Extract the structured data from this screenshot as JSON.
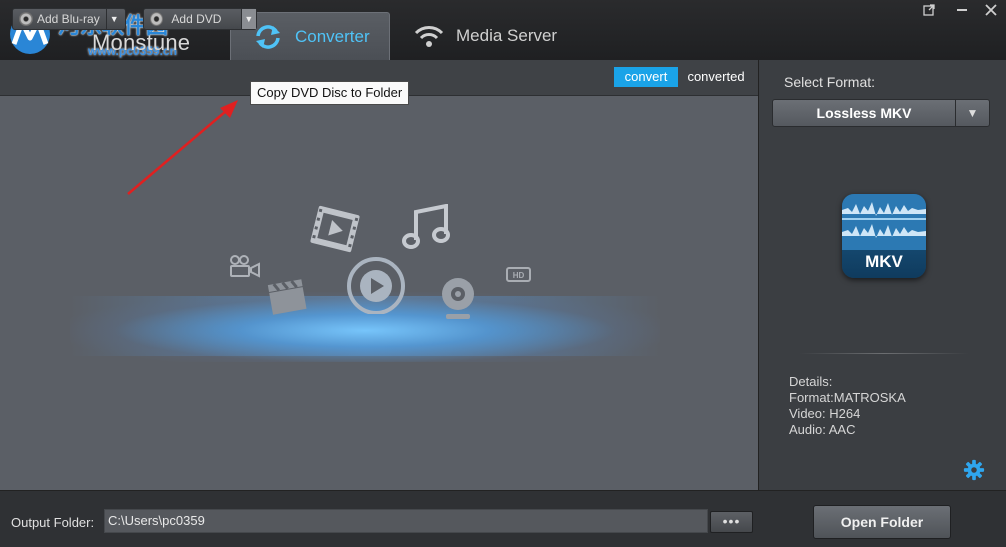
{
  "header": {
    "logo_text": "Monstune",
    "watermark": "河东软件园",
    "watermark_url": "www.pc0359.cn",
    "tabs": [
      {
        "label": "Converter",
        "icon": "refresh-icon",
        "active": true
      },
      {
        "label": "Media Server",
        "icon": "wifi-icon",
        "active": false
      }
    ],
    "window_controls": [
      "popout-icon",
      "minimize-icon",
      "close-icon"
    ]
  },
  "toolbar": {
    "add_bluray_label": "Add Blu-ray",
    "add_dvd_label": "Add DVD",
    "convert_label": "convert",
    "converted_label": "converted",
    "tooltip": "Copy DVD Disc to Folder"
  },
  "main": {
    "placeholder_icons": [
      "video-camera-icon",
      "film-icon",
      "music-note-icon",
      "play-circle-icon",
      "webcam-icon",
      "hd-icon",
      "clapperboard-icon"
    ]
  },
  "sidebar": {
    "select_format_label": "Select Format:",
    "selected_format": "Lossless MKV",
    "format_icon_label": "MKV",
    "details": [
      "Details:",
      "Format:MATROSKA",
      "Video: H264",
      "Audio: AAC"
    ]
  },
  "footer": {
    "output_label": "Output Folder:",
    "output_path": "C:\\Users\\pc0359",
    "browse_label": "•••",
    "open_folder_label": "Open Folder"
  },
  "colors": {
    "accent": "#1aa3e8",
    "tab_text_active": "#4fc3f7",
    "main_bg": "#5b5f66",
    "panel_bg": "#3b3e42"
  }
}
